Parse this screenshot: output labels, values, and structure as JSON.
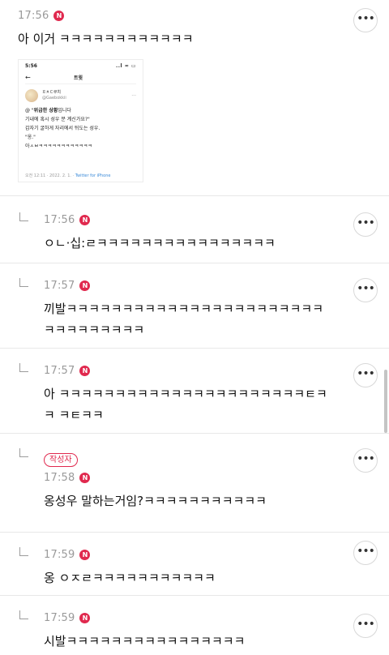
{
  "post": {
    "time": "17:56",
    "badge": "N",
    "text": "아 이거 ㅋㅋㅋㅋㅋㅋㅋㅋㅋㅋㅋㅋ",
    "more_label": "•••",
    "tweet": {
      "status_time": "5:56",
      "status_icons": "..l ≈ ▭",
      "back": "←",
      "title": "트윗",
      "user_name": "ㅍㅊㄷ쿠치",
      "user_handle": "@Gaebokkii",
      "line1_prefix": "@ \"",
      "line1_bold": "위급한 상황",
      "line1_suffix": "입니다",
      "line2": "기내에 혹시 성우 분 계신가요?\"",
      "line3": "갑자기 굴하게 자리에서 뒤도는 성우.",
      "line4": "\"옹.\"",
      "line5": "아ㅅㅂㅋㅋㅋㅋㅋㅋㅋㅋㅋㅋㅋㅋ",
      "footer_prefix": "오전 12:11 · 2022. 2. 1. · ",
      "footer_link": "Twitter for iPhone"
    }
  },
  "replies": [
    {
      "time": "17:56",
      "badge": "N",
      "author": "",
      "text": "ㅇㄴ·십:ㄹㅋㅋㅋㅋㅋㅋㅋㅋㅋㅋㅋㅋㅋㅋㅋㅋ",
      "more_label": "•••"
    },
    {
      "time": "17:57",
      "badge": "N",
      "author": "",
      "text": "끼발ㅋㅋㅋㅋㅋㅋㅋㅋㅋㅋㅋㅋㅋㅋㅋㅋㅋㅋㅋㅋㅋㅋㅋ ㅋㅋㅋㅋㅋㅋㅋㅋㅋ",
      "more_label": "•••"
    },
    {
      "time": "17:57",
      "badge": "N",
      "author": "",
      "text": "아 ㅋㅋㅋㅋㅋㅋㅋㅋㅋㅋㅋㅋㅋㅋㅋㅋㅋㅋㅋㅋㅋㅋㅌㅋㅋ ㅋㅌㅋㅋ",
      "more_label": "•••"
    },
    {
      "time": "17:58",
      "badge": "N",
      "author": "작성자",
      "text": "옹성우 말하는거임?ㅋㅋㅋㅋㅋㅋㅋㅋㅋㅋㅋ",
      "more_label": "•••"
    },
    {
      "time": "17:59",
      "badge": "N",
      "author": "",
      "text": "옹 ㅇㅈㄹㅋㅋㅋㅋㅋㅋㅋㅋㅋㅋㅋ",
      "more_label": "•••"
    },
    {
      "time": "17:59",
      "badge": "N",
      "author": "",
      "text": "시발ㅋㅋㅋㅋㅋㅋㅋㅋㅋㅋㅋㅋㅋㅋㅋㅋ",
      "more_label": "•••"
    }
  ]
}
